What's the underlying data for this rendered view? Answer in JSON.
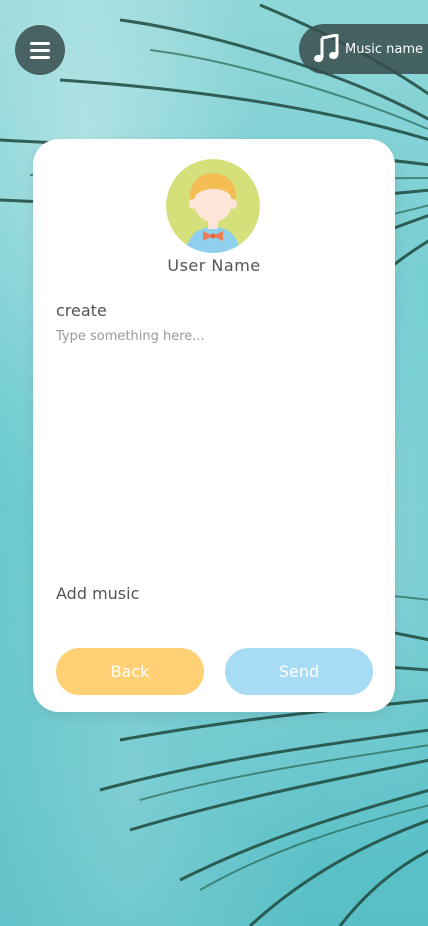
{
  "header": {
    "menu_icon": "hamburger-menu-icon",
    "music_icon": "music-note-icon",
    "music_name": "Music name"
  },
  "profile": {
    "user_name": "User Name",
    "avatar_icon": "user-avatar-icon"
  },
  "compose": {
    "create_label": "create",
    "placeholder": "Type something here...",
    "value": "",
    "add_music_label": "Add music"
  },
  "actions": {
    "back_label": "Back",
    "send_label": "Send"
  },
  "colors": {
    "back_button": "#ffd074",
    "send_button": "#a8dcf5",
    "overlay": "#384c4e",
    "card": "#ffffff"
  }
}
